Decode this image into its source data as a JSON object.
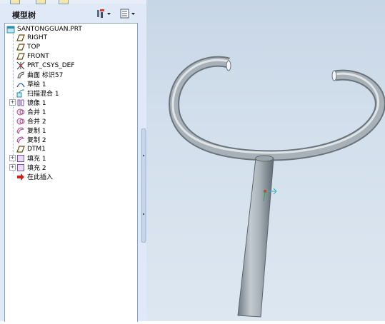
{
  "panel": {
    "title": "模型树",
    "colors": {
      "panel_bg": "#dfe9f7",
      "viewport_bg": "#d3dfec",
      "pipe": "#9aa5ad"
    }
  },
  "toolbar": {
    "settings_icon": "tree-settings-icon",
    "show_icon": "tree-show-icon"
  },
  "tree": {
    "root": "SANTONGGUAN.PRT",
    "items": [
      {
        "label": "RIGHT",
        "icon": "datum-plane-icon"
      },
      {
        "label": "TOP",
        "icon": "datum-plane-icon"
      },
      {
        "label": "FRONT",
        "icon": "datum-plane-icon"
      },
      {
        "label": "PRT_CSYS_DEF",
        "icon": "coordinate-system-icon"
      },
      {
        "label": "曲面 标识57",
        "icon": "surface-icon"
      },
      {
        "label": "草绘 1",
        "icon": "sketch-icon"
      },
      {
        "label": "扫描混合 1",
        "icon": "swept-blend-icon"
      },
      {
        "label": "镜像 1",
        "icon": "mirror-icon",
        "expandable": true
      },
      {
        "label": "合并 1",
        "icon": "merge-icon"
      },
      {
        "label": "合并 2",
        "icon": "merge-icon"
      },
      {
        "label": "复制 1",
        "icon": "copy-icon"
      },
      {
        "label": "复制 2",
        "icon": "copy-icon"
      },
      {
        "label": "DTM1",
        "icon": "datum-plane-icon"
      },
      {
        "label": "填充 1",
        "icon": "fill-icon",
        "expandable": true
      },
      {
        "label": "填充 2",
        "icon": "fill-icon",
        "expandable": true
      },
      {
        "label": "在此插入",
        "icon": "insert-here-arrow-icon"
      }
    ]
  }
}
